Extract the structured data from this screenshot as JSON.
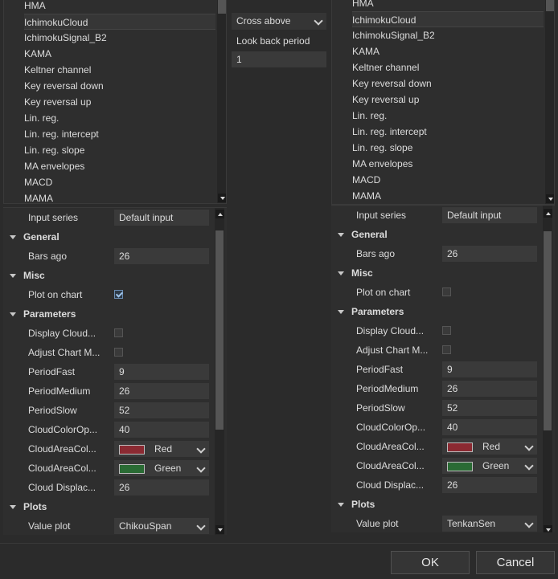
{
  "indicator_list_items": [
    "HMA",
    "IchimokuCloud",
    "IchimokuSignal_B2",
    "KAMA",
    "Keltner channel",
    "Key reversal down",
    "Key reversal up",
    "Lin. reg.",
    "Lin. reg. intercept",
    "Lin. reg. slope",
    "MA envelopes",
    "MACD",
    "MAMA"
  ],
  "condition": {
    "operator": "Cross above",
    "lookback_label": "Look back period",
    "lookback_value": "1"
  },
  "left": {
    "input_series_label": "Input series",
    "input_series_value": "Default input",
    "general_label": "General",
    "bars_ago_label": "Bars ago",
    "bars_ago_value": "26",
    "misc_label": "Misc",
    "plot_on_chart_label": "Plot on chart",
    "plot_on_chart_checked": true,
    "parameters_label": "Parameters",
    "display_cloud_label": "Display Cloud...",
    "adjust_chart_label": "Adjust Chart M...",
    "period_fast_label": "PeriodFast",
    "period_fast_value": "9",
    "period_medium_label": "PeriodMedium",
    "period_medium_value": "26",
    "period_slow_label": "PeriodSlow",
    "period_slow_value": "52",
    "cloud_opacity_label": "CloudColorOp...",
    "cloud_opacity_value": "40",
    "cloud_area_1_label": "CloudAreaCol...",
    "cloud_area_1_value": "Red",
    "cloud_area_2_label": "CloudAreaCol...",
    "cloud_area_2_value": "Green",
    "cloud_displacement_label": "Cloud Displac...",
    "cloud_displacement_value": "26",
    "plots_label": "Plots",
    "value_plot_label": "Value plot",
    "value_plot_value": "ChikouSpan"
  },
  "right": {
    "input_series_label": "Input series",
    "input_series_value": "Default input",
    "general_label": "General",
    "bars_ago_label": "Bars ago",
    "bars_ago_value": "26",
    "misc_label": "Misc",
    "plot_on_chart_label": "Plot on chart",
    "plot_on_chart_checked": false,
    "parameters_label": "Parameters",
    "display_cloud_label": "Display Cloud...",
    "adjust_chart_label": "Adjust Chart M...",
    "period_fast_label": "PeriodFast",
    "period_fast_value": "9",
    "period_medium_label": "PeriodMedium",
    "period_medium_value": "26",
    "period_slow_label": "PeriodSlow",
    "period_slow_value": "52",
    "cloud_opacity_label": "CloudColorOp...",
    "cloud_opacity_value": "40",
    "cloud_area_1_label": "CloudAreaCol...",
    "cloud_area_1_value": "Red",
    "cloud_area_2_label": "CloudAreaCol...",
    "cloud_area_2_value": "Green",
    "cloud_displacement_label": "Cloud Displac...",
    "cloud_displacement_value": "26",
    "plots_label": "Plots",
    "value_plot_label": "Value plot",
    "value_plot_value": "TenkanSen"
  },
  "colors": {
    "red_swatch": "#8b2a32",
    "green_swatch": "#2a6b34"
  },
  "buttons": {
    "ok": "OK",
    "cancel": "Cancel"
  }
}
